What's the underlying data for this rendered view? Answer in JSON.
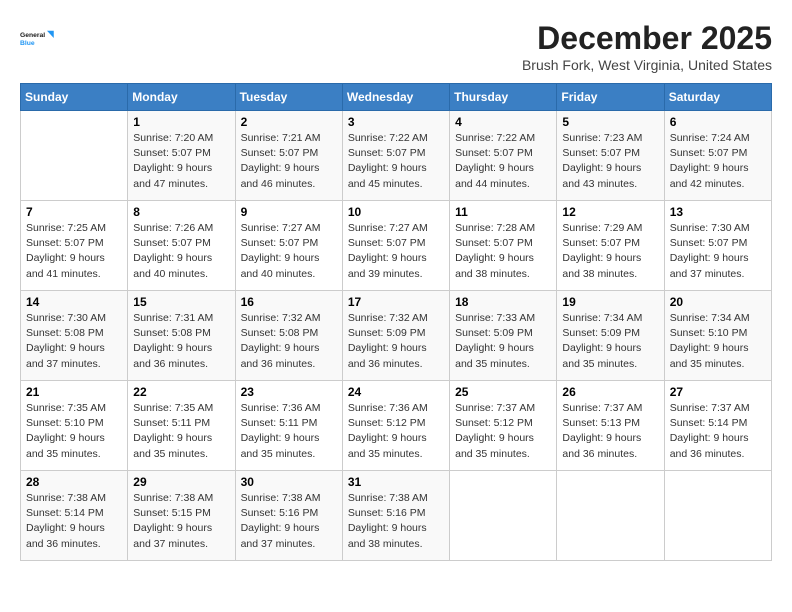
{
  "header": {
    "logo_line1": "General",
    "logo_line2": "Blue",
    "month_title": "December 2025",
    "location": "Brush Fork, West Virginia, United States"
  },
  "days_of_week": [
    "Sunday",
    "Monday",
    "Tuesday",
    "Wednesday",
    "Thursday",
    "Friday",
    "Saturday"
  ],
  "weeks": [
    [
      {
        "day": "",
        "info": ""
      },
      {
        "day": "1",
        "info": "Sunrise: 7:20 AM\nSunset: 5:07 PM\nDaylight: 9 hours\nand 47 minutes."
      },
      {
        "day": "2",
        "info": "Sunrise: 7:21 AM\nSunset: 5:07 PM\nDaylight: 9 hours\nand 46 minutes."
      },
      {
        "day": "3",
        "info": "Sunrise: 7:22 AM\nSunset: 5:07 PM\nDaylight: 9 hours\nand 45 minutes."
      },
      {
        "day": "4",
        "info": "Sunrise: 7:22 AM\nSunset: 5:07 PM\nDaylight: 9 hours\nand 44 minutes."
      },
      {
        "day": "5",
        "info": "Sunrise: 7:23 AM\nSunset: 5:07 PM\nDaylight: 9 hours\nand 43 minutes."
      },
      {
        "day": "6",
        "info": "Sunrise: 7:24 AM\nSunset: 5:07 PM\nDaylight: 9 hours\nand 42 minutes."
      }
    ],
    [
      {
        "day": "7",
        "info": "Sunrise: 7:25 AM\nSunset: 5:07 PM\nDaylight: 9 hours\nand 41 minutes."
      },
      {
        "day": "8",
        "info": "Sunrise: 7:26 AM\nSunset: 5:07 PM\nDaylight: 9 hours\nand 40 minutes."
      },
      {
        "day": "9",
        "info": "Sunrise: 7:27 AM\nSunset: 5:07 PM\nDaylight: 9 hours\nand 40 minutes."
      },
      {
        "day": "10",
        "info": "Sunrise: 7:27 AM\nSunset: 5:07 PM\nDaylight: 9 hours\nand 39 minutes."
      },
      {
        "day": "11",
        "info": "Sunrise: 7:28 AM\nSunset: 5:07 PM\nDaylight: 9 hours\nand 38 minutes."
      },
      {
        "day": "12",
        "info": "Sunrise: 7:29 AM\nSunset: 5:07 PM\nDaylight: 9 hours\nand 38 minutes."
      },
      {
        "day": "13",
        "info": "Sunrise: 7:30 AM\nSunset: 5:07 PM\nDaylight: 9 hours\nand 37 minutes."
      }
    ],
    [
      {
        "day": "14",
        "info": "Sunrise: 7:30 AM\nSunset: 5:08 PM\nDaylight: 9 hours\nand 37 minutes."
      },
      {
        "day": "15",
        "info": "Sunrise: 7:31 AM\nSunset: 5:08 PM\nDaylight: 9 hours\nand 36 minutes."
      },
      {
        "day": "16",
        "info": "Sunrise: 7:32 AM\nSunset: 5:08 PM\nDaylight: 9 hours\nand 36 minutes."
      },
      {
        "day": "17",
        "info": "Sunrise: 7:32 AM\nSunset: 5:09 PM\nDaylight: 9 hours\nand 36 minutes."
      },
      {
        "day": "18",
        "info": "Sunrise: 7:33 AM\nSunset: 5:09 PM\nDaylight: 9 hours\nand 35 minutes."
      },
      {
        "day": "19",
        "info": "Sunrise: 7:34 AM\nSunset: 5:09 PM\nDaylight: 9 hours\nand 35 minutes."
      },
      {
        "day": "20",
        "info": "Sunrise: 7:34 AM\nSunset: 5:10 PM\nDaylight: 9 hours\nand 35 minutes."
      }
    ],
    [
      {
        "day": "21",
        "info": "Sunrise: 7:35 AM\nSunset: 5:10 PM\nDaylight: 9 hours\nand 35 minutes."
      },
      {
        "day": "22",
        "info": "Sunrise: 7:35 AM\nSunset: 5:11 PM\nDaylight: 9 hours\nand 35 minutes."
      },
      {
        "day": "23",
        "info": "Sunrise: 7:36 AM\nSunset: 5:11 PM\nDaylight: 9 hours\nand 35 minutes."
      },
      {
        "day": "24",
        "info": "Sunrise: 7:36 AM\nSunset: 5:12 PM\nDaylight: 9 hours\nand 35 minutes."
      },
      {
        "day": "25",
        "info": "Sunrise: 7:37 AM\nSunset: 5:12 PM\nDaylight: 9 hours\nand 35 minutes."
      },
      {
        "day": "26",
        "info": "Sunrise: 7:37 AM\nSunset: 5:13 PM\nDaylight: 9 hours\nand 36 minutes."
      },
      {
        "day": "27",
        "info": "Sunrise: 7:37 AM\nSunset: 5:14 PM\nDaylight: 9 hours\nand 36 minutes."
      }
    ],
    [
      {
        "day": "28",
        "info": "Sunrise: 7:38 AM\nSunset: 5:14 PM\nDaylight: 9 hours\nand 36 minutes."
      },
      {
        "day": "29",
        "info": "Sunrise: 7:38 AM\nSunset: 5:15 PM\nDaylight: 9 hours\nand 37 minutes."
      },
      {
        "day": "30",
        "info": "Sunrise: 7:38 AM\nSunset: 5:16 PM\nDaylight: 9 hours\nand 37 minutes."
      },
      {
        "day": "31",
        "info": "Sunrise: 7:38 AM\nSunset: 5:16 PM\nDaylight: 9 hours\nand 38 minutes."
      },
      {
        "day": "",
        "info": ""
      },
      {
        "day": "",
        "info": ""
      },
      {
        "day": "",
        "info": ""
      }
    ]
  ]
}
